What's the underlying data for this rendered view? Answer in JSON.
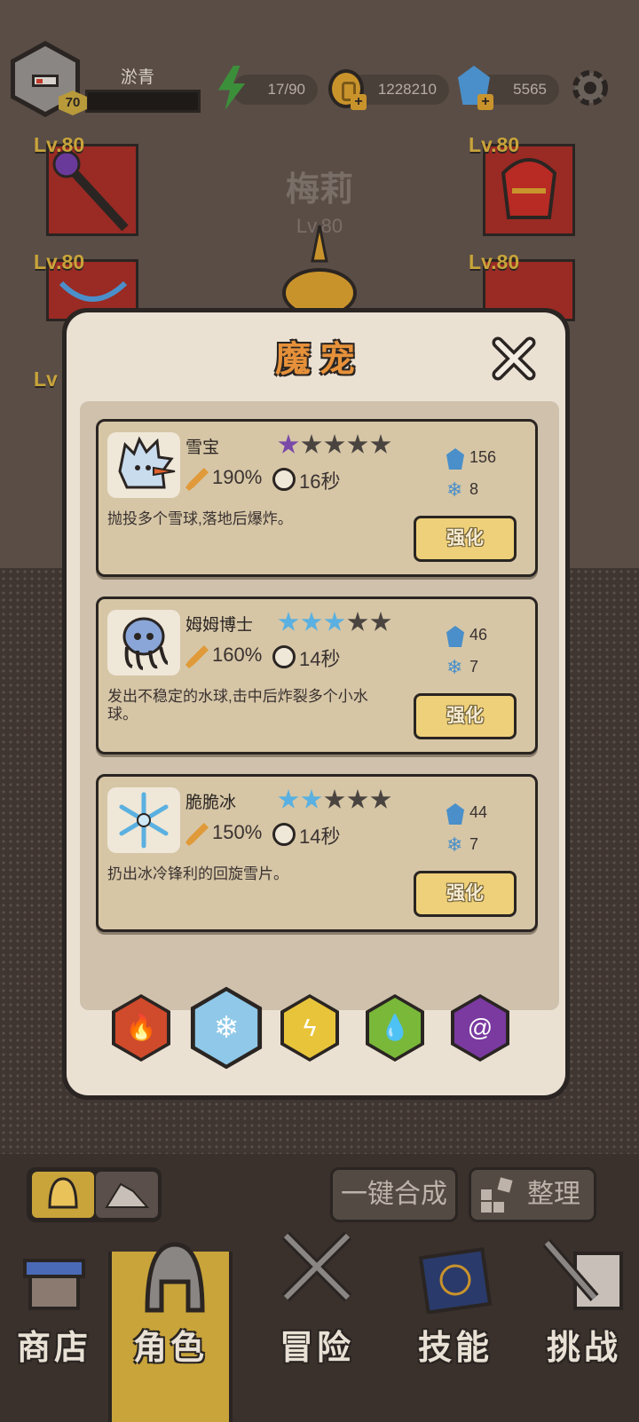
{
  "player": {
    "name": "淤青",
    "level": "70"
  },
  "resources": {
    "energy": "17/90",
    "gold": "1228210",
    "gems": "5565"
  },
  "hero": {
    "name": "梅莉",
    "level": "Lv.80"
  },
  "equipment": {
    "left_top_level": "Lv.80",
    "left_mid_level": "Lv.80",
    "left_low_level": "Lv",
    "right_top_level": "Lv.80",
    "right_mid_level": "Lv.80"
  },
  "modal": {
    "title": "魔宠",
    "pets": [
      {
        "name": "雪宝",
        "stars_filled": 1,
        "star_color": "#7a4aa8",
        "attack": "190%",
        "cooldown": "16秒",
        "gem_cost": "156",
        "ice_cost": "8",
        "description": "抛投多个雪球,落地后爆炸。",
        "button": "强化"
      },
      {
        "name": "姆姆博士",
        "stars_filled": 3,
        "star_color": "#5ab0e0",
        "attack": "160%",
        "cooldown": "14秒",
        "gem_cost": "46",
        "ice_cost": "7",
        "description": "发出不稳定的水球,击中后炸裂多个小水球。",
        "button": "强化"
      },
      {
        "name": "脆脆冰",
        "stars_filled": 2,
        "star_color": "#5ab0e0",
        "attack": "150%",
        "cooldown": "14秒",
        "gem_cost": "44",
        "ice_cost": "7",
        "description": "扔出冰冷锋利的回旋雪片。",
        "button": "强化"
      }
    ],
    "element_tabs": [
      {
        "name": "fire",
        "color": "#d04a2c",
        "icon": "fire-icon"
      },
      {
        "name": "ice",
        "color": "#8fc8e8",
        "icon": "snowflake-icon",
        "active": true
      },
      {
        "name": "lightning",
        "color": "#e8c43a",
        "icon": "lightning-icon"
      },
      {
        "name": "poison",
        "color": "#7ab83a",
        "icon": "droplets-icon"
      },
      {
        "name": "dark",
        "color": "#7a3aa0",
        "icon": "vortex-icon"
      }
    ]
  },
  "bottom": {
    "merge_button": "一键合成",
    "sort_button": "整理"
  },
  "nav": [
    {
      "label": "商店",
      "icon": "shop-icon"
    },
    {
      "label": "角色",
      "icon": "helmet-icon",
      "active": true
    },
    {
      "label": "冒险",
      "icon": "swords-icon"
    },
    {
      "label": "技能",
      "icon": "spellbook-icon"
    },
    {
      "label": "挑战",
      "icon": "sword-scroll-icon"
    }
  ]
}
